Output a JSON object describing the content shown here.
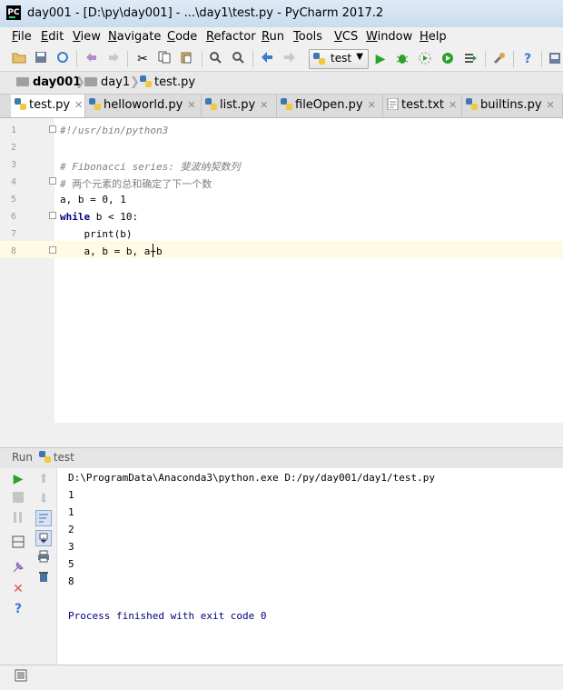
{
  "window": {
    "title": "day001 - [D:\\py\\day001] - ...\\day1\\test.py - PyCharm 2017.2",
    "logo_text": "PC"
  },
  "menu": [
    "File",
    "Edit",
    "View",
    "Navigate",
    "Code",
    "Refactor",
    "Run",
    "Tools",
    "VCS",
    "Window",
    "Help"
  ],
  "toolbar": {
    "run_config_label": "test"
  },
  "breadcrumb": [
    "day001",
    "day1",
    "test.py"
  ],
  "tabs": [
    "test.py",
    "helloworld.py",
    "list.py",
    "fileOpen.py",
    "test.txt",
    "builtins.py"
  ],
  "editor": {
    "line_numbers": [
      "1",
      "2",
      "3",
      "4",
      "5",
      "6",
      "7",
      "8"
    ],
    "lines": {
      "l1": "#!/usr/bin/python3",
      "l3": "# Fibonacci series: 斐波纳契数列",
      "l4": "# 两个元素的总和确定了下一个数",
      "l5": "a, b = 0, 1",
      "l6_kw": "while",
      "l6_rest": " b < 10:",
      "l7": "    print(b)",
      "l8": "    a, b = b, a+b"
    }
  },
  "run_panel": {
    "label": "Run",
    "config": "test",
    "output": [
      "D:\\ProgramData\\Anaconda3\\python.exe D:/py/day001/day1/test.py",
      "1",
      "1",
      "2",
      "3",
      "5",
      "8",
      "",
      "Process finished with exit code 0"
    ]
  },
  "colors": {
    "accent_green": "#21d789",
    "run_green": "#2ca02c",
    "keyword": "#000080",
    "current_line": "#fffae3"
  }
}
